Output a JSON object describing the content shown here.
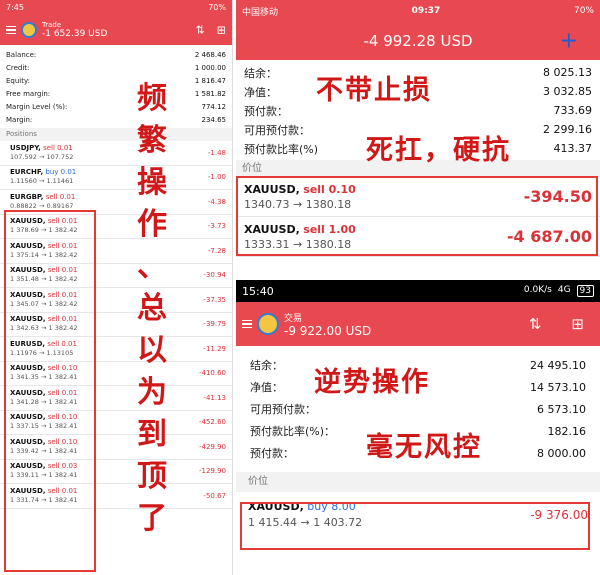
{
  "left": {
    "status": {
      "time": "7:45",
      "battery": "70%"
    },
    "header": {
      "title": "Trade",
      "value": "-1 652.39 USD"
    },
    "account": [
      {
        "label": "Balance:",
        "value": "2 468.46"
      },
      {
        "label": "Credit:",
        "value": "1 000.00"
      },
      {
        "label": "Equity:",
        "value": "1 816.47"
      },
      {
        "label": "Free margin:",
        "value": "1 581.82"
      },
      {
        "label": "Margin Level (%):",
        "value": "774.12"
      },
      {
        "label": "Margin:",
        "value": "234.65"
      }
    ],
    "section": "Positions",
    "positions": [
      {
        "symbol": "USDJPY,",
        "side": "sell 0.01",
        "dir": "sell",
        "prices": "107.592 → 107.752",
        "pl": "-1.48"
      },
      {
        "symbol": "EURCHF,",
        "side": "buy 0.01",
        "dir": "buy",
        "prices": "1.11560 → 1.11461",
        "pl": "-1.00"
      },
      {
        "symbol": "EURGBP,",
        "side": "sell 0.01",
        "dir": "sell",
        "prices": "0.88822 → 0.89167",
        "pl": "-4.38"
      },
      {
        "symbol": "XAUUSD,",
        "side": "sell 0.01",
        "dir": "sell",
        "prices": "1 378.69 → 1 382.42",
        "pl": "-3.73"
      },
      {
        "symbol": "XAUUSD,",
        "side": "sell 0.01",
        "dir": "sell",
        "prices": "1 375.14 → 1 382.42",
        "pl": "-7.28"
      },
      {
        "symbol": "XAUUSD,",
        "side": "sell 0.01",
        "dir": "sell",
        "prices": "1 351.48 → 1 382.42",
        "pl": "-30.94"
      },
      {
        "symbol": "XAUUSD,",
        "side": "sell 0.01",
        "dir": "sell",
        "prices": "1 345.07 → 1 382.42",
        "pl": "-37.35"
      },
      {
        "symbol": "XAUUSD,",
        "side": "sell 0.01",
        "dir": "sell",
        "prices": "1 342.63 → 1 382.42",
        "pl": "-39.79"
      },
      {
        "symbol": "EURUSD,",
        "side": "sell 0.01",
        "dir": "sell",
        "prices": "1.11976 → 1.13105",
        "pl": "-11.29"
      },
      {
        "symbol": "XAUUSD,",
        "side": "sell 0.10",
        "dir": "sell",
        "prices": "1 341.35 → 1 382.41",
        "pl": "-410.60"
      },
      {
        "symbol": "XAUUSD,",
        "side": "sell 0.01",
        "dir": "sell",
        "prices": "1 341.28 → 1 382.41",
        "pl": "-41.13"
      },
      {
        "symbol": "XAUUSD,",
        "side": "sell 0.10",
        "dir": "sell",
        "prices": "1 337.15 → 1 382.41",
        "pl": "-452.60"
      },
      {
        "symbol": "XAUUSD,",
        "side": "sell 0.10",
        "dir": "sell",
        "prices": "1 339.42 → 1 382.41",
        "pl": "-429.90"
      },
      {
        "symbol": "XAUUSD,",
        "side": "sell 0.03",
        "dir": "sell",
        "prices": "1 339.11 → 1 382.41",
        "pl": "-129.90"
      },
      {
        "symbol": "XAUUSD,",
        "side": "sell 0.01",
        "dir": "sell",
        "prices": "1 331.74 → 1 382.41",
        "pl": "-50.67"
      }
    ],
    "overlay": [
      "频",
      "繁",
      "操",
      "作",
      "、",
      "总",
      "以",
      "为",
      "到",
      "顶",
      "了"
    ]
  },
  "rightTop": {
    "status": {
      "carrier": "中国移动",
      "time": "09:37",
      "battery": "70%"
    },
    "header": {
      "value": "-4 992.28 USD",
      "plus": "+"
    },
    "account": [
      {
        "label": "结余：",
        "value": "8 025.13"
      },
      {
        "label": "净值：",
        "value": "3 032.85"
      },
      {
        "label": "预付款：",
        "value": "733.69"
      },
      {
        "label": "可用预付款：",
        "value": "2 299.16"
      },
      {
        "label": "预付款比率(%)",
        "value": "413.37"
      }
    ],
    "section": "价位",
    "positions": [
      {
        "symbol": "XAUUSD,",
        "side": "sell 0.10",
        "prices": "1340.73 → 1380.18",
        "pl": "-394.50"
      },
      {
        "symbol": "XAUUSD,",
        "side": "sell 1.00",
        "prices": "1333.31 → 1380.18",
        "pl": "-4 687.00"
      }
    ],
    "overlay1": "不带止损",
    "overlay2": "死扛，硬抗"
  },
  "rightBottom": {
    "status": {
      "time": "15:40",
      "net": "0.0K/s",
      "signal": "4G",
      "battery": "93"
    },
    "header": {
      "title": "交易",
      "value": "-9 922.00 USD"
    },
    "account": [
      {
        "label": "结余：",
        "value": "24 495.10"
      },
      {
        "label": "净值：",
        "value": "14 573.10"
      },
      {
        "label": "可用预付款：",
        "value": "6 573.10"
      },
      {
        "label": "预付款比率(%)：",
        "value": "182.16"
      },
      {
        "label": "预付款：",
        "value": "8 000.00"
      }
    ],
    "section": "价位",
    "positions": [
      {
        "symbol": "XAUUSD,",
        "side": "buy 8.00",
        "prices": "1 415.44 → 1 403.72",
        "pl": "-9 376.00"
      }
    ],
    "overlay1": "逆势操作",
    "overlay2": "毫无风控"
  },
  "colors": {
    "header": "#e84850",
    "loss": "#d9333a",
    "buy": "#2b6fd6",
    "highlight": "#e53935"
  }
}
